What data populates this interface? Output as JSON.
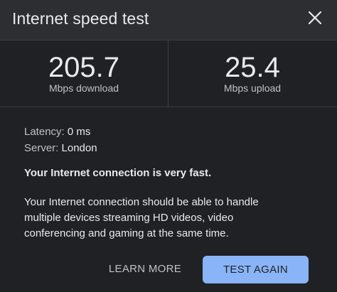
{
  "dialog": {
    "title": "Internet speed test",
    "close_icon": "close-icon"
  },
  "metrics": {
    "download": {
      "value": "205.7",
      "unit": "Mbps download"
    },
    "upload": {
      "value": "25.4",
      "unit": "Mbps upload"
    }
  },
  "details": {
    "latency_label": "Latency:",
    "latency_value": "0 ms",
    "server_label": "Server:",
    "server_value": "London"
  },
  "summary": "Your Internet connection is very fast.",
  "description_lines": [
    "Your Internet connection should be able to handle",
    "multiple devices streaming HD videos, video",
    "conferencing and gaming at the same time."
  ],
  "actions": {
    "learn_more": "LEARN MORE",
    "test_again": "TEST AGAIN"
  },
  "colors": {
    "background": "#202124",
    "header": "#2d2e31",
    "accent": "#8ab4f8"
  }
}
